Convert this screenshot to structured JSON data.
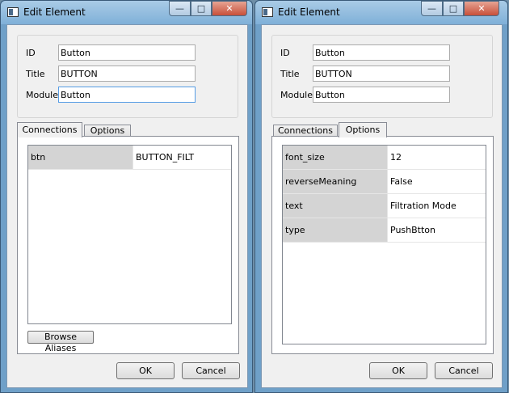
{
  "dialogs": [
    {
      "title": "Edit Element",
      "fields": {
        "id_label": "ID",
        "id_value": "Button",
        "title_label": "Title",
        "title_value": "BUTTON",
        "module_label": "Module",
        "module_value": "Button"
      },
      "tabs": [
        "Connections",
        "Options"
      ],
      "active_tab": "Connections",
      "connections": [
        {
          "key": "btn",
          "value": "BUTTON_FILT"
        }
      ],
      "browse_label": "Browse Aliases",
      "ok_label": "OK",
      "cancel_label": "Cancel"
    },
    {
      "title": "Edit Element",
      "fields": {
        "id_label": "ID",
        "id_value": "Button",
        "title_label": "Title",
        "title_value": "BUTTON",
        "module_label": "Module",
        "module_value": "Button"
      },
      "tabs": [
        "Connections",
        "Options"
      ],
      "active_tab": "Options",
      "options": [
        {
          "key": "font_size",
          "value": "12"
        },
        {
          "key": "reverseMeaning",
          "value": "False"
        },
        {
          "key": "text",
          "value": "Filtration Mode"
        },
        {
          "key": "type",
          "value": "PushBtton"
        }
      ],
      "ok_label": "OK",
      "cancel_label": "Cancel"
    }
  ],
  "window_controls": {
    "minimize": "—",
    "maximize": "□",
    "close": "✕"
  },
  "colors": {
    "window_frame": "#6fa0c8",
    "client_bg": "#f0f0f0",
    "property_key_bg": "#d4d4d4",
    "close_button": "#c8503a",
    "focus_border": "#569de5"
  }
}
